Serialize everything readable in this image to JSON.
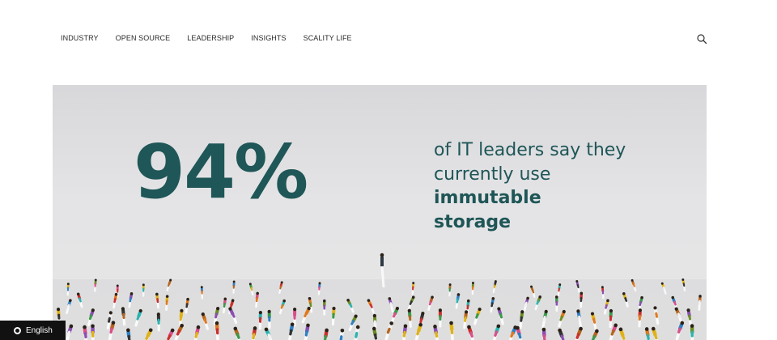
{
  "nav": {
    "items": [
      {
        "label": "INDUSTRY"
      },
      {
        "label": "OPEN SOURCE"
      },
      {
        "label": "LEADERSHIP"
      },
      {
        "label": "INSIGHTS"
      },
      {
        "label": "SCALITY LIFE"
      }
    ],
    "search_icon": "search-icon"
  },
  "hero": {
    "stat_value": "94%",
    "caption_line1": "of IT leaders say they",
    "caption_line2": "currently use",
    "caption_line3": "immutable",
    "caption_line4": "storage",
    "text_color": "#1f5657",
    "background_color": "#e3e3e5"
  },
  "language": {
    "label": "English",
    "icon": "globe-ring-icon"
  }
}
